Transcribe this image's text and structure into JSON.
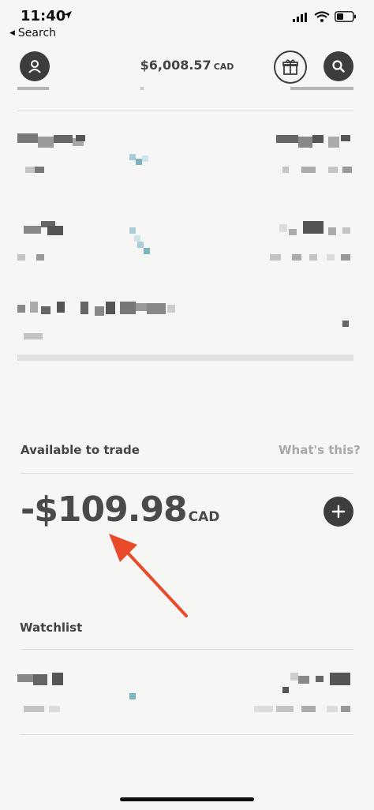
{
  "status_bar": {
    "time": "11:40",
    "icons": [
      "location-arrow-icon",
      "signal-icon",
      "wifi-icon",
      "battery-icon"
    ]
  },
  "nav": {
    "back_label": "Search"
  },
  "header": {
    "balance": "$6,008.57",
    "balance_currency": "CAD",
    "icons": [
      "profile-icon",
      "gift-icon",
      "search-icon"
    ]
  },
  "available": {
    "label": "Available to trade",
    "help_link": "What's this?",
    "amount": "-$109.98",
    "currency": "CAD"
  },
  "watchlist": {
    "title": "Watchlist"
  },
  "colors": {
    "background": "#f6f6f4",
    "dark": "#3d3d3d",
    "muted": "#a9a9a9",
    "arrow": "#e84a2a",
    "accent": "#7fb3c4"
  }
}
